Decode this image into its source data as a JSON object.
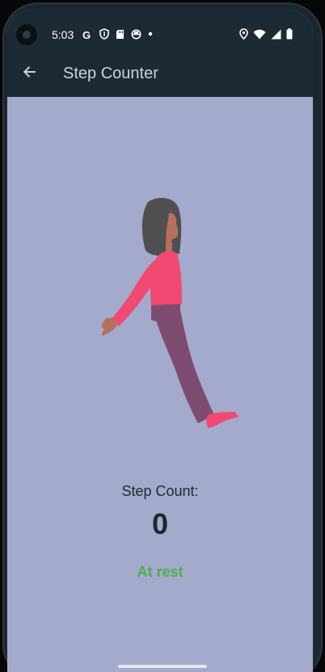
{
  "status_bar": {
    "time": "5:03",
    "left_icons": [
      "google-icon",
      "shield-icon",
      "sd-card-icon",
      "app-icon",
      "dot-icon"
    ],
    "right_icons": [
      "location-icon",
      "wifi-icon",
      "signal-icon",
      "battery-icon"
    ]
  },
  "app_bar": {
    "title": "Step Counter",
    "back_icon": "arrow-back-icon"
  },
  "main": {
    "step_label": "Step Count:",
    "step_value": "0",
    "activity_status": "At rest"
  },
  "colors": {
    "app_bar": "#1c2b33",
    "background": "#a3aacb",
    "status_green": "#4caf50",
    "shirt": "#f04a72",
    "pants": "#7e4c70",
    "hair": "#4f4f4f"
  }
}
